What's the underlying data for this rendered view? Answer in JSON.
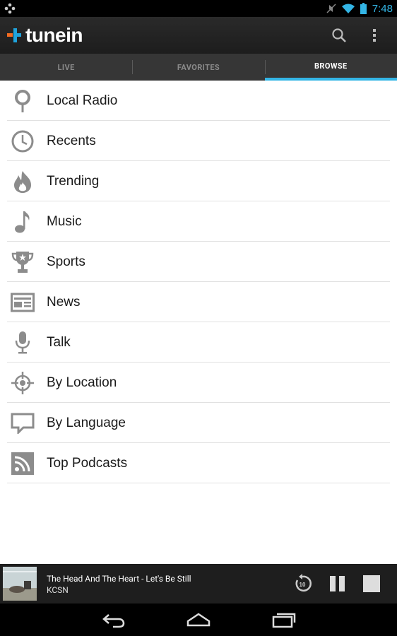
{
  "status_bar": {
    "time": "7:48",
    "icons": [
      "notification-icon",
      "mute-icon",
      "wifi-icon",
      "battery-icon"
    ]
  },
  "app": {
    "name": "tunein",
    "action_icons": [
      "search-icon",
      "overflow-menu-icon"
    ]
  },
  "tabs": [
    {
      "label": "LIVE",
      "active": false
    },
    {
      "label": "FAVORITES",
      "active": false
    },
    {
      "label": "BROWSE",
      "active": true
    }
  ],
  "browse_list": [
    {
      "label": "Local Radio",
      "icon": "location-pin-icon"
    },
    {
      "label": "Recents",
      "icon": "clock-icon"
    },
    {
      "label": "Trending",
      "icon": "flame-icon"
    },
    {
      "label": "Music",
      "icon": "music-note-icon"
    },
    {
      "label": "Sports",
      "icon": "trophy-icon"
    },
    {
      "label": "News",
      "icon": "newspaper-icon"
    },
    {
      "label": "Talk",
      "icon": "microphone-icon"
    },
    {
      "label": "By Location",
      "icon": "compass-icon"
    },
    {
      "label": "By Language",
      "icon": "speech-bubble-icon"
    },
    {
      "label": "Top Podcasts",
      "icon": "rss-icon"
    }
  ],
  "now_playing": {
    "title": "The Head And The Heart - Let's Be Still",
    "station": "KCSN",
    "controls": [
      "rewind-10-icon",
      "pause-icon",
      "stop-icon"
    ]
  },
  "nav_bar": [
    "back-icon",
    "home-icon",
    "recents-icon"
  ],
  "colors": {
    "accent": "#33b5e5",
    "logo_orange": "#f26b21",
    "logo_blue": "#1fa3dc"
  }
}
